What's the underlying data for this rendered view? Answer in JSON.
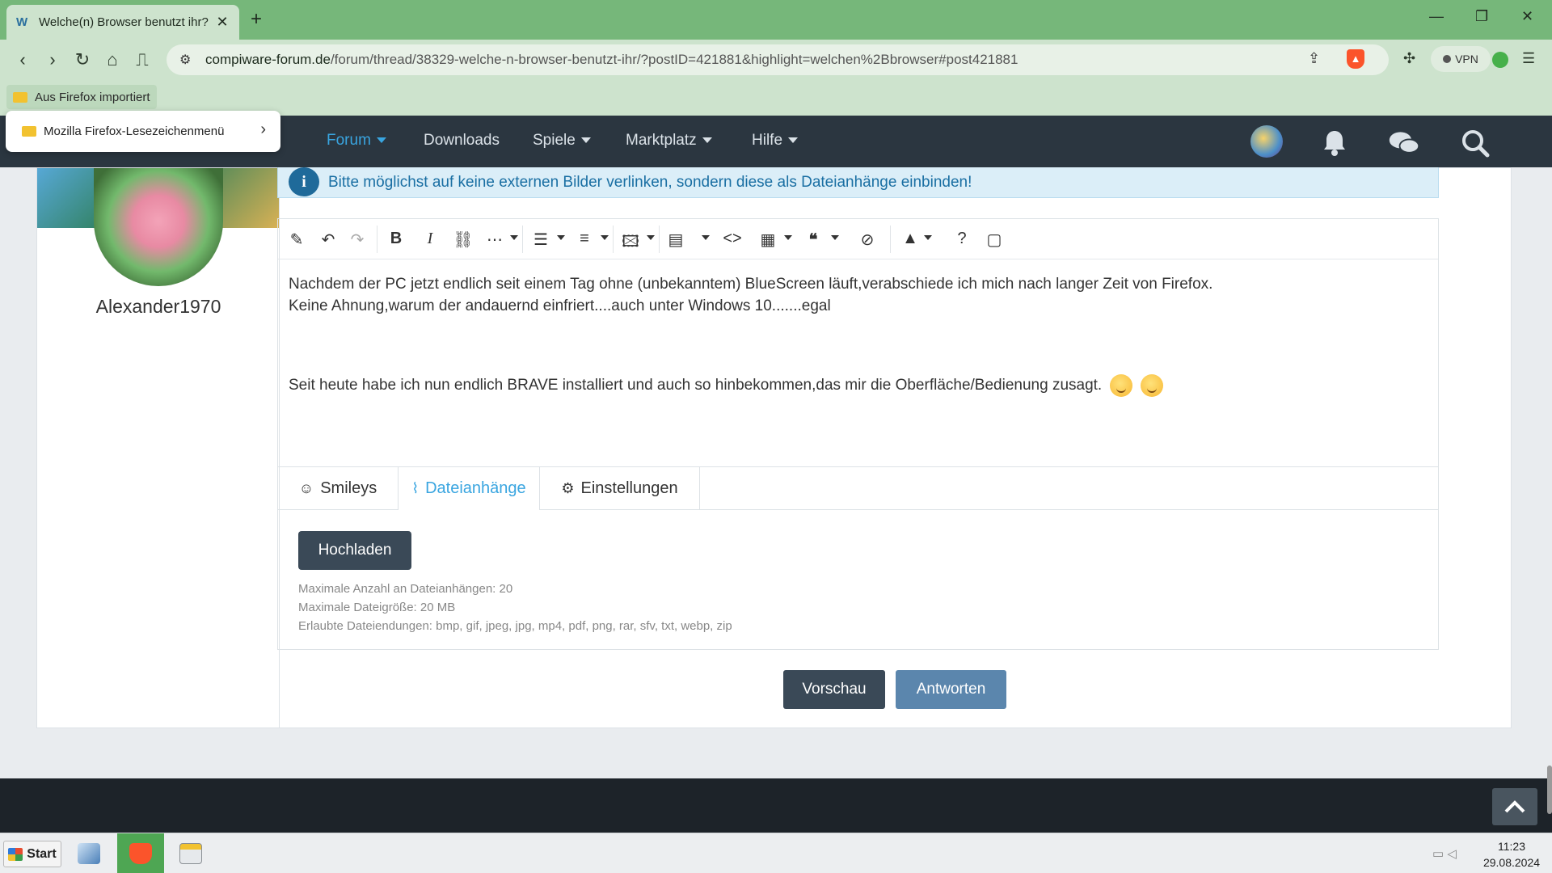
{
  "browser": {
    "tab_title": "Welche(n) Browser benutzt ihr?",
    "url_host": "compiware-forum.de",
    "url_path": "/forum/thread/38329-welche-n-browser-benutzt-ihr/?postID=421881&highlight=welchen%2Bbrowser#post421881",
    "vpn_label": "VPN",
    "bookmark_folder": "Aus Firefox importiert",
    "bookmark_popup_item": "Mozilla Firefox-Lesezeichenmenü"
  },
  "forum_nav": {
    "items": [
      {
        "label": "Forum",
        "dropdown": true,
        "active": true
      },
      {
        "label": "Downloads",
        "dropdown": false,
        "active": false
      },
      {
        "label": "Spiele",
        "dropdown": true,
        "active": false
      },
      {
        "label": "Marktplatz",
        "dropdown": true,
        "active": false
      },
      {
        "label": "Hilfe",
        "dropdown": true,
        "active": false
      }
    ],
    "icons": [
      "bell-icon",
      "chat-bubbles-icon",
      "search-icon"
    ]
  },
  "user": {
    "name": "Alexander1970"
  },
  "notice": {
    "text": "Bitte möglichst auf keine externen Bilder verlinken, sondern diese als Dateianhänge einbinden!"
  },
  "editor": {
    "lines": [
      "Nachdem der PC jetzt endlich seit einem Tag ohne (unbekanntem) BlueScreen läuft,verabschiede ich mich nach langer Zeit von Firefox.",
      "Keine Ahnung,warum der andauernd einfriert....auch unter Windows 10.......egal",
      "Seit heute habe ich nun endlich BRAVE installiert und auch so hinbekommen,das mir die Oberfläche/Bedienung zusagt."
    ],
    "tabs": [
      {
        "label": "Smileys",
        "active": false
      },
      {
        "label": "Dateianhänge",
        "active": true
      },
      {
        "label": "Einstellungen",
        "active": false
      }
    ],
    "upload_label": "Hochladen",
    "limits": [
      "Maximale Anzahl an Dateianhängen: 20",
      "Maximale Dateigröße: 20 MB",
      "Erlaubte Dateiendungen: bmp, gif, jpeg, jpg, mp4, pdf, png, rar, sfv, txt, webp, zip"
    ]
  },
  "actions": {
    "preview_label": "Vorschau",
    "reply_label": "Antworten"
  },
  "taskbar": {
    "start_label": "Start",
    "time": "11:23",
    "date": "29.08.2024"
  },
  "colors": {
    "accent": "#39a5e0",
    "nav_bg": "#2b3640",
    "chrome_green": "#76b77a",
    "button_dark": "#3a4957",
    "button_reply": "#5b86ad"
  }
}
